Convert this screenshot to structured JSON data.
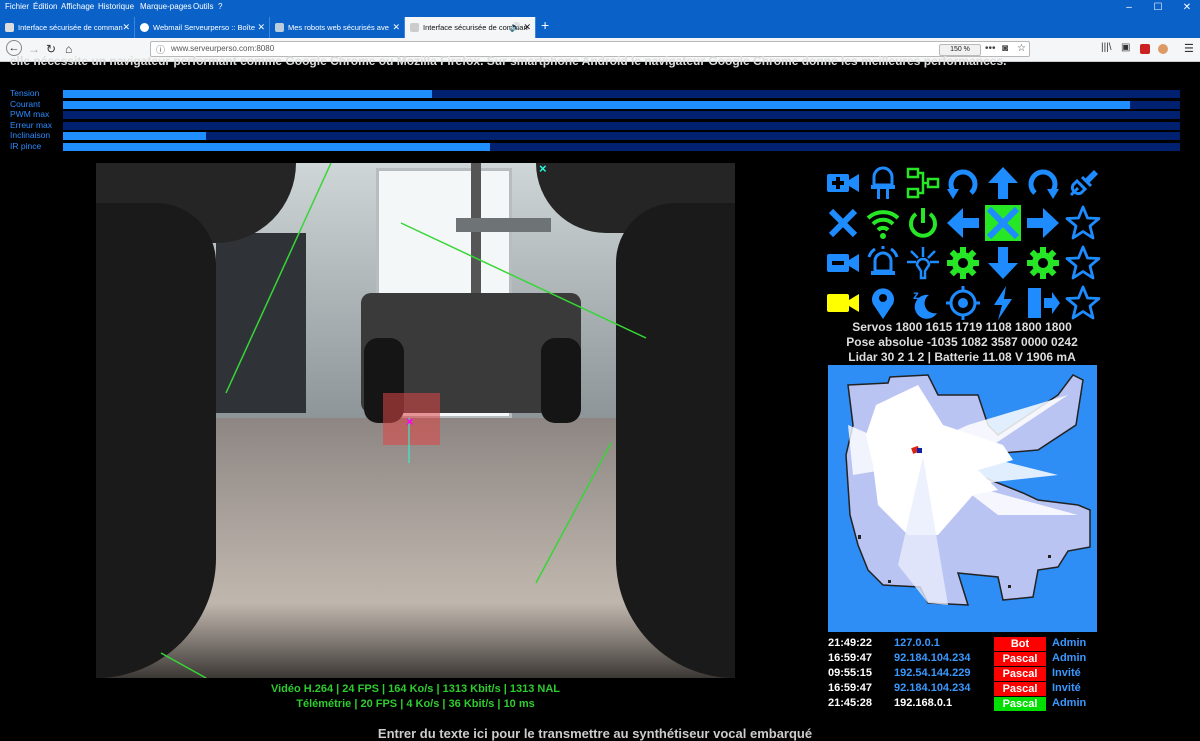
{
  "browser": {
    "menu": [
      "Fichier",
      "Édition",
      "Affichage",
      "Historique",
      "Marque-pages",
      "Outils",
      "?"
    ],
    "tabs": [
      {
        "title": "Interface sécurisée de comman",
        "active": false
      },
      {
        "title": "Webmail Serveurperso :: Boîte",
        "active": false
      },
      {
        "title": "Mes robots web sécurisés ave",
        "active": false
      },
      {
        "title": "Interface sécurisée de comman",
        "active": true
      }
    ],
    "url": "www.serveurperso.com:8080",
    "zoom": "150 %"
  },
  "page": {
    "intro": "elle nécessite un navigateur performant comme Google Chrome ou Mozilla Firefox. Sur smartphone Android le navigateur Google Chrome donne les meilleures performances."
  },
  "gauges": [
    {
      "label": "Tension",
      "level": 0.33
    },
    {
      "label": "Courant",
      "level": 0.955
    },
    {
      "label": "PWM max",
      "level": 0
    },
    {
      "label": "Erreur max",
      "level": 0
    },
    {
      "label": "Inclinaison",
      "level": 0.128
    },
    {
      "label": "IR pince",
      "level": 0.382
    }
  ],
  "video": {
    "stats_line1": "Vidéo H.264 | 24 FPS | 164 Ko/s | 1313 Kbit/s | 1313 NAL",
    "stats_line2": "Télémétrie | 20 FPS | 4 Ko/s | 36 Kbit/s | 10 ms"
  },
  "controls": {
    "icons": [
      [
        "video-add-icon",
        "led-icon",
        "network-icon",
        "rotate-left-icon",
        "arrow-up-icon",
        "rotate-right-icon",
        "plug-icon"
      ],
      [
        "close-icon",
        "wifi-icon",
        "power-icon",
        "arrow-left-icon",
        "stop-icon",
        "arrow-right-icon",
        "star-icon"
      ],
      [
        "video-icon",
        "alarm-icon",
        "lamp-icon",
        "settings-icon",
        "arrow-down-icon",
        "settings-icon",
        "star-icon"
      ],
      [
        "camera-icon",
        "location-icon",
        "sleep-icon",
        "target-icon",
        "lightning-icon",
        "exit-icon",
        "star-icon"
      ]
    ],
    "colors": {
      "blue": "#1e8cff",
      "green": "#26e626",
      "yellow": "#ffff00",
      "stop_bg": "#26e626"
    }
  },
  "telemetry": {
    "servos": "Servos 1800 1615 1719 1108 1800 1800",
    "pose": "Pose absolue -1035 1082 3587 0000 0242",
    "lidar": "Lidar 30 2 1 2 | Batterie 11.08 V 1906 mA"
  },
  "sessions": [
    {
      "time": "21:49:22",
      "ip": "127.0.0.1",
      "name": "Bot",
      "name_color": "#ff0000",
      "role": "Admin"
    },
    {
      "time": "16:59:47",
      "ip": "92.184.104.234",
      "name": "Pascal",
      "name_color": "#ff0000",
      "role": "Admin"
    },
    {
      "time": "09:55:15",
      "ip": "192.54.144.229",
      "name": "Pascal",
      "name_color": "#ff0000",
      "role": "Invité"
    },
    {
      "time": "16:59:47",
      "ip": "92.184.104.234",
      "name": "Pascal",
      "name_color": "#ff0000",
      "role": "Invité"
    },
    {
      "time": "21:45:28",
      "ip": "192.168.0.1",
      "name": "Pascal",
      "name_color": "#00dd00",
      "role": "Admin",
      "ip_color": "#ffffff"
    }
  ],
  "speech": {
    "placeholder": "Entrer du texte ici pour le transmettre au synthétiseur vocal embarqué"
  }
}
